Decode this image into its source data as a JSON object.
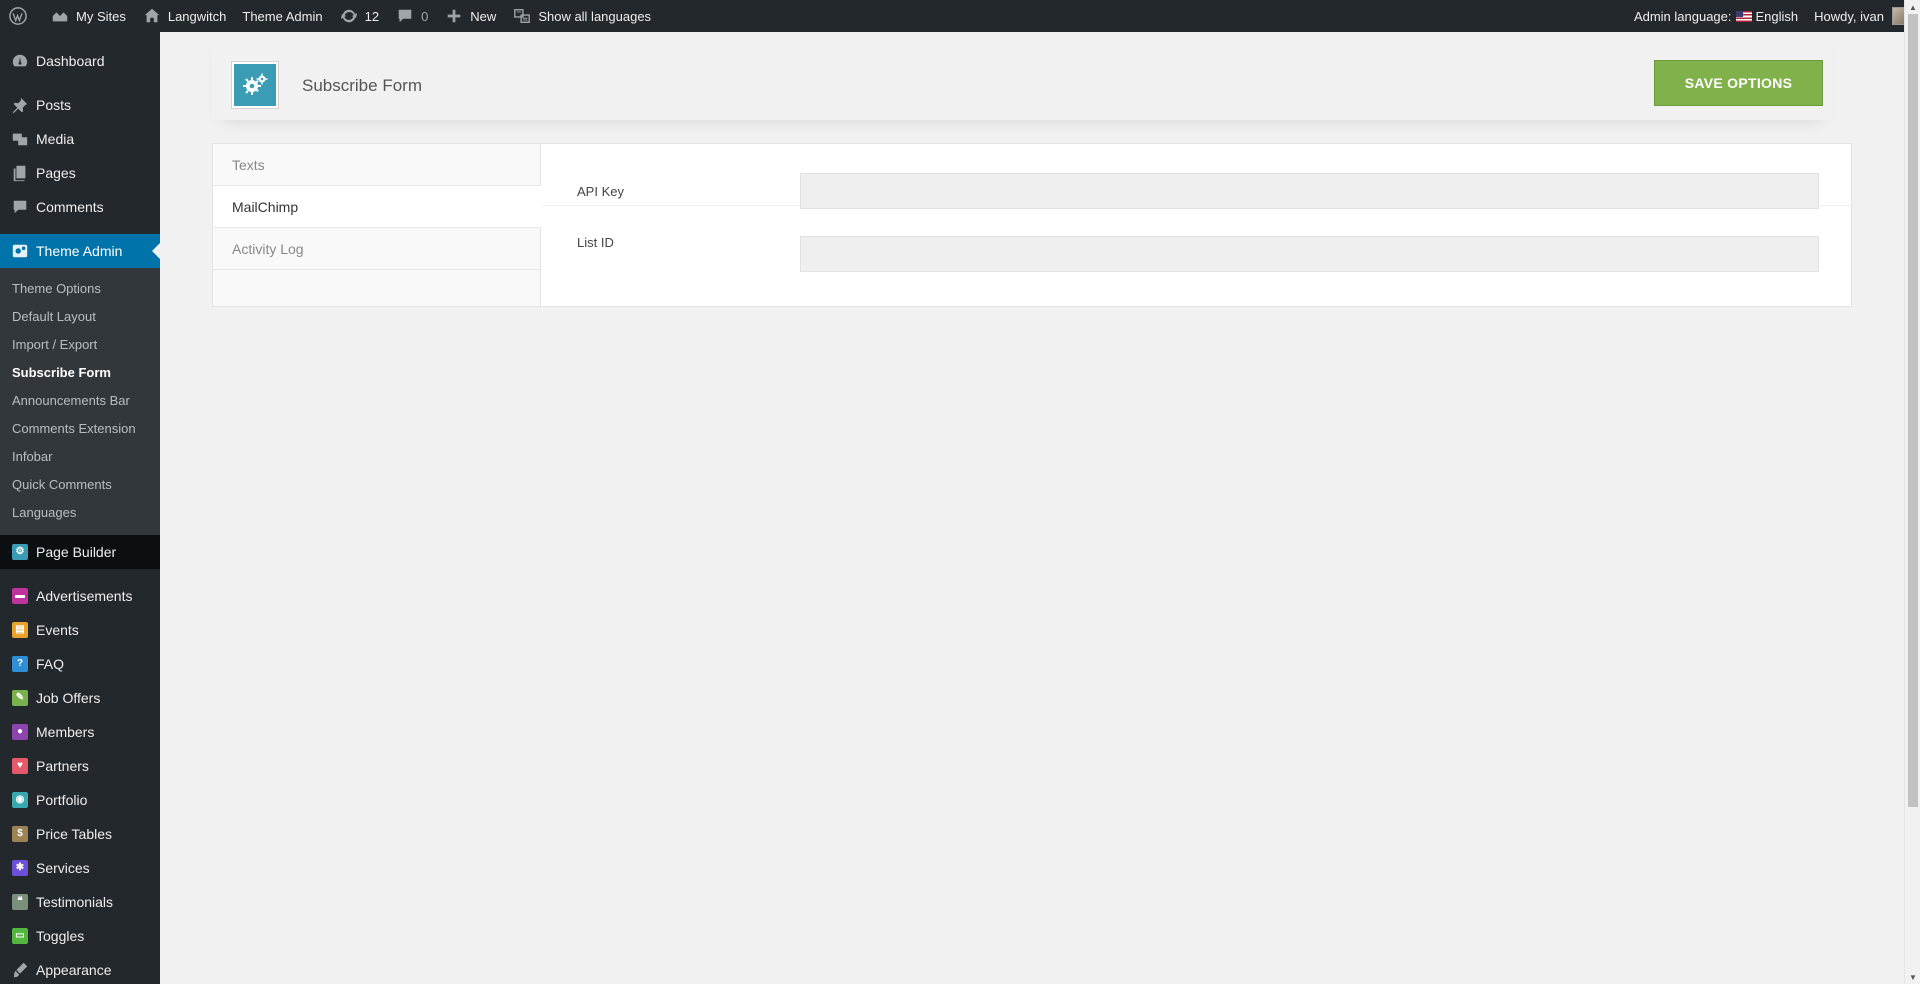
{
  "adminbar": {
    "my_sites": "My Sites",
    "site_name": "Langwitch",
    "theme_admin": "Theme Admin",
    "updates_count": "12",
    "comments_count": "0",
    "new_label": "New",
    "show_languages": "Show all languages",
    "admin_language_label": "Admin language:",
    "admin_language_value": "English",
    "howdy": "Howdy, ivan"
  },
  "sidebar": {
    "dashboard": "Dashboard",
    "posts": "Posts",
    "media": "Media",
    "pages": "Pages",
    "comments": "Comments",
    "theme_admin": "Theme Admin",
    "submenu": [
      "Theme Options",
      "Default Layout",
      "Import / Export",
      "Subscribe Form",
      "Announcements Bar",
      "Comments Extension",
      "Infobar",
      "Quick Comments",
      "Languages"
    ],
    "active_submenu": "Subscribe Form",
    "page_builder": "Page Builder",
    "post_types": [
      {
        "label": "Advertisements",
        "color": "#c0329b",
        "icon": "megaphone-icon"
      },
      {
        "label": "Events",
        "color": "#e9a32c",
        "icon": "calendar-icon"
      },
      {
        "label": "FAQ",
        "color": "#2f8fd6",
        "icon": "question-icon"
      },
      {
        "label": "Job Offers",
        "color": "#79b24a",
        "icon": "briefcase-icon"
      },
      {
        "label": "Members",
        "color": "#8e44ad",
        "icon": "user-icon"
      },
      {
        "label": "Partners",
        "color": "#e45a6b",
        "icon": "heart-icon"
      },
      {
        "label": "Portfolio",
        "color": "#39a9b0",
        "icon": "camera-icon"
      },
      {
        "label": "Price Tables",
        "color": "#9d8253",
        "icon": "dollar-icon"
      },
      {
        "label": "Services",
        "color": "#6b4fd8",
        "icon": "gear-icon"
      },
      {
        "label": "Testimonials",
        "color": "#7b8f7b",
        "icon": "quote-icon"
      },
      {
        "label": "Toggles",
        "color": "#53b63d",
        "icon": "toggle-icon"
      }
    ],
    "appearance": "Appearance"
  },
  "page": {
    "title": "Subscribe Form",
    "save_label": "SAVE OPTIONS",
    "icon": "gears-icon",
    "accent_color": "#3b9db5",
    "save_color": "#80b14a"
  },
  "tabs": [
    "Texts",
    "MailChimp",
    "Activity Log"
  ],
  "active_tab": "MailChimp",
  "fields": {
    "api_key": {
      "label": "API Key",
      "value": ""
    },
    "list_id": {
      "label": "List ID",
      "value": ""
    }
  }
}
